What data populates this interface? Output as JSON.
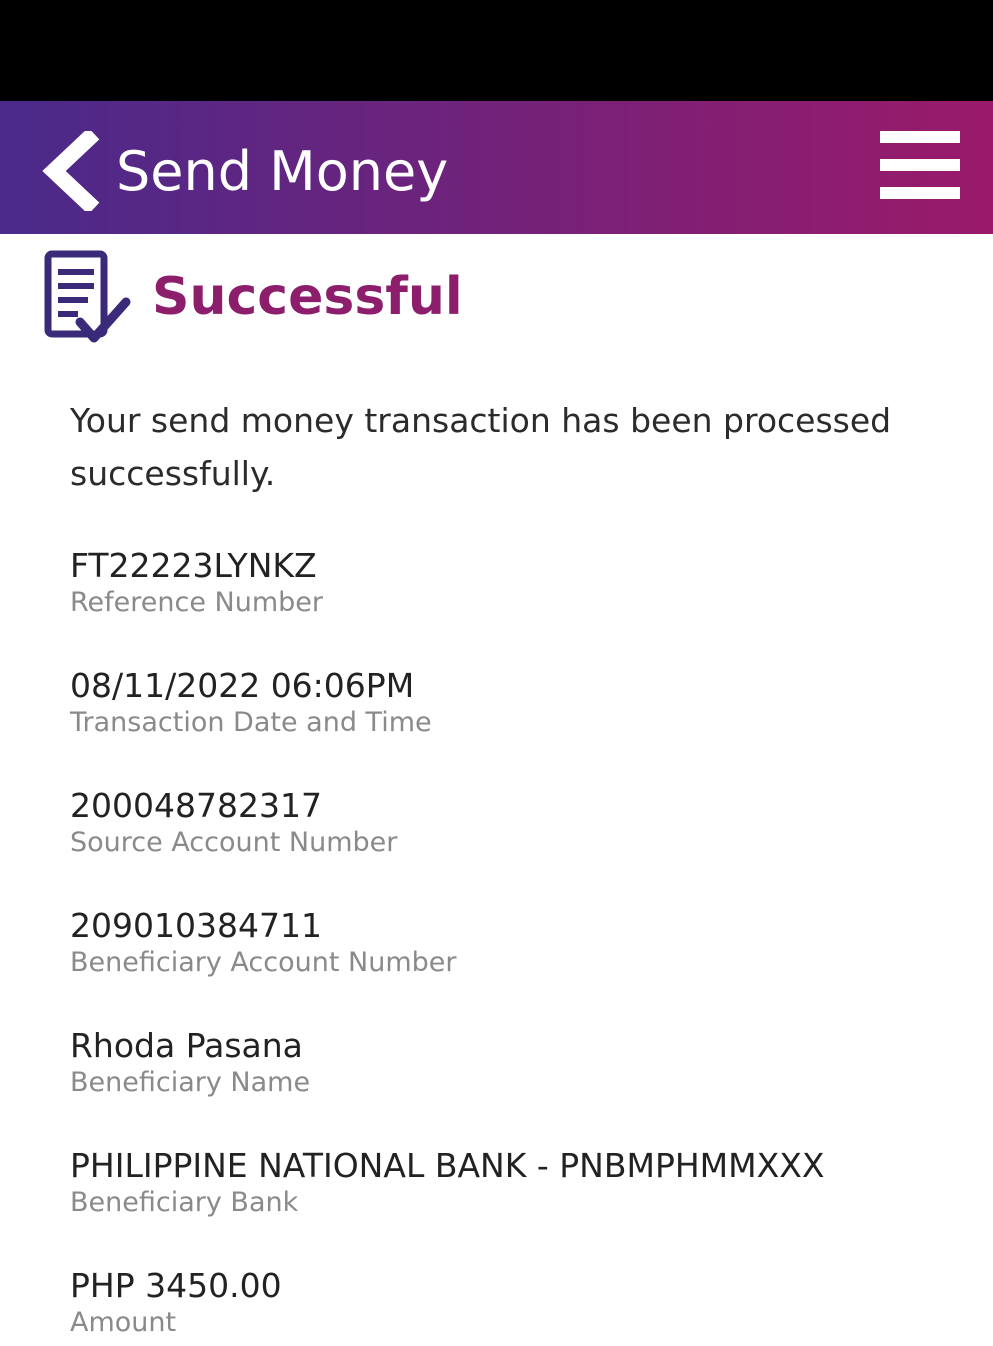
{
  "header": {
    "title": "Send Money",
    "back_icon": "chevron-left-icon",
    "menu_icon": "hamburger-menu-icon",
    "gradient_start": "#4a2a8a",
    "gradient_end": "#9a1a6a"
  },
  "status": {
    "icon": "document-check-icon",
    "title": "Successful",
    "title_color": "#8c1e6c",
    "message": "Your send money transaction has been processed successfully."
  },
  "details": [
    {
      "value": "FT22223LYNKZ",
      "label": "Reference Number"
    },
    {
      "value": "08/11/2022 06:06PM",
      "label": "Transaction Date and Time"
    },
    {
      "value": "200048782317",
      "label": "Source Account Number"
    },
    {
      "value": "209010384711",
      "label": "Beneficiary Account Number"
    },
    {
      "value": "Rhoda Pasana",
      "label": "Beneficiary Name"
    },
    {
      "value": "PHILIPPINE NATIONAL BANK - PNBMPHMMXXX",
      "label": "Beneficiary Bank"
    },
    {
      "value": "PHP 3450.00",
      "label": "Amount"
    }
  ]
}
